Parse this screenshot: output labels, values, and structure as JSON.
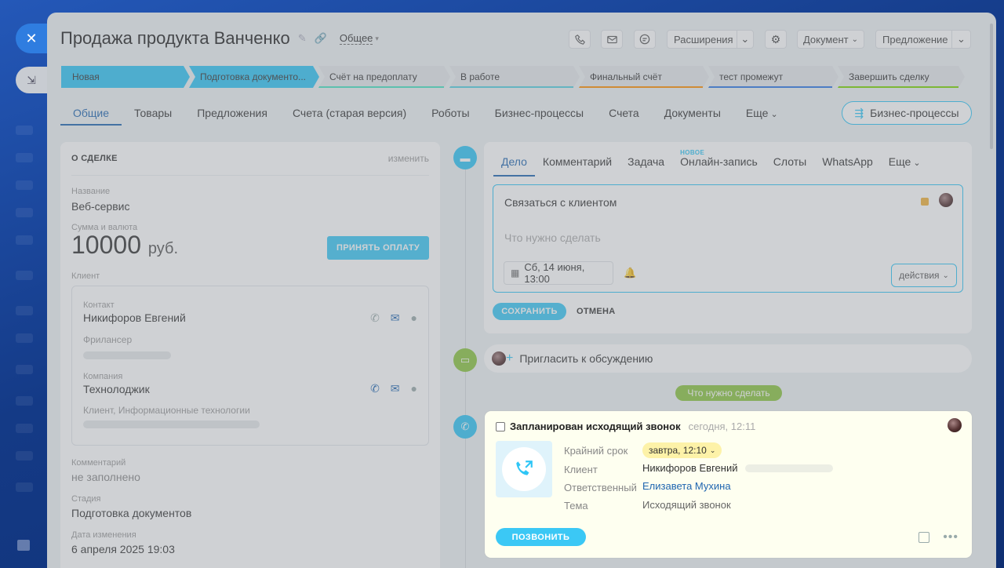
{
  "header": {
    "title": "Продажа продукта Ванченко",
    "category": "Общее",
    "extensions_label": "Расширения",
    "document_label": "Документ",
    "offer_label": "Предложение"
  },
  "stages": [
    {
      "label": "Новая",
      "color": "#2fc6f6",
      "active": true
    },
    {
      "label": "Подготовка документо...",
      "color": "#2fc6f6",
      "active": true
    },
    {
      "label": "Счёт на предоплату",
      "color": "#47e4c2",
      "active": false
    },
    {
      "label": "В работе",
      "color": "#55d0e0",
      "active": false
    },
    {
      "label": "Финальный счёт",
      "color": "#ff8f00",
      "active": false
    },
    {
      "label": "тест промежут",
      "color": "#2e78e6",
      "active": false
    },
    {
      "label": "Завершить сделку",
      "color": "#7bd500",
      "active": false
    }
  ],
  "tabs": [
    "Общие",
    "Товары",
    "Предложения",
    "Счета (старая версия)",
    "Роботы",
    "Бизнес-процессы",
    "Счета",
    "Документы",
    "Еще"
  ],
  "bp_button": "Бизнес-процессы",
  "deal": {
    "section_title": "О СДЕЛКЕ",
    "edit_label": "изменить",
    "name_label": "Название",
    "name_value": "Веб-сервис",
    "amount_label": "Сумма и валюта",
    "amount": "10000",
    "currency": "руб.",
    "pay_button": "ПРИНЯТЬ ОПЛАТУ",
    "client_label": "Клиент",
    "contact_label": "Контакт",
    "contact_name": "Никифоров Евгений",
    "contact_position": "Фрилансер",
    "company_label": "Компания",
    "company_name": "Технолоджик",
    "company_type": "Клиент, Информационные технологии",
    "comment_label": "Комментарий",
    "comment_value": "не заполнено",
    "stage_label": "Стадия",
    "stage_value": "Подготовка документов",
    "modified_label": "Дата изменения",
    "modified_value": "6 апреля 2025 19:03"
  },
  "editor": {
    "tabs": [
      "Дело",
      "Комментарий",
      "Задача",
      "Онлайн-запись",
      "Слоты",
      "WhatsApp",
      "Еще"
    ],
    "new_badge": "НОВОЕ",
    "todo_title": "Связаться с клиентом",
    "todo_placeholder": "Что нужно сделать",
    "date": "Сб, 14 июня, 13:00",
    "actions": "действия",
    "save": "СОХРАНИТЬ",
    "cancel": "ОТМЕНА"
  },
  "invite_label": "Пригласить к обсуждению",
  "todo_section_label": "Что нужно сделать",
  "activity": {
    "title": "Запланирован исходящий звонок",
    "time": "сегодня, 12:11",
    "deadline_label": "Крайний срок",
    "deadline_value": "завтра, 12:10",
    "client_label": "Клиент",
    "client_value": "Никифоров Евгений",
    "responsible_label": "Ответственный",
    "responsible_value": "Елизавета Мухина",
    "subject_label": "Тема",
    "subject_value": "Исходящий звонок",
    "call_button": "ПОЗВОНИТЬ"
  },
  "colors": {
    "accent": "#2fc6f6",
    "link": "#2066b0",
    "todo_green": "#8cc63f",
    "activity_bg": "#fefff0"
  }
}
